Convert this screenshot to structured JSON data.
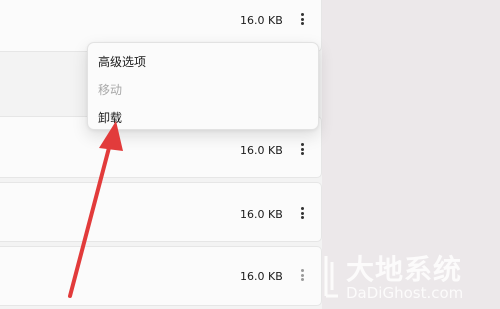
{
  "apps": [
    {
      "size": "16.0 KB"
    },
    {
      "size": "16.0 KB"
    },
    {
      "size": "16.0 KB"
    },
    {
      "size": "16.0 KB"
    }
  ],
  "context_menu": {
    "items": [
      {
        "label": "高级选项",
        "enabled": true
      },
      {
        "label": "移动",
        "enabled": false
      },
      {
        "label": "卸载",
        "enabled": true
      }
    ]
  },
  "annotation": {
    "arrow_color": "#e23b3b"
  },
  "watermark": {
    "title": "大地系统",
    "domain": "DaDiGhost.com"
  },
  "colors": {
    "background": "#f3f3f3",
    "card": "#fbfbfb",
    "disabled_text": "#a8a8a8"
  }
}
